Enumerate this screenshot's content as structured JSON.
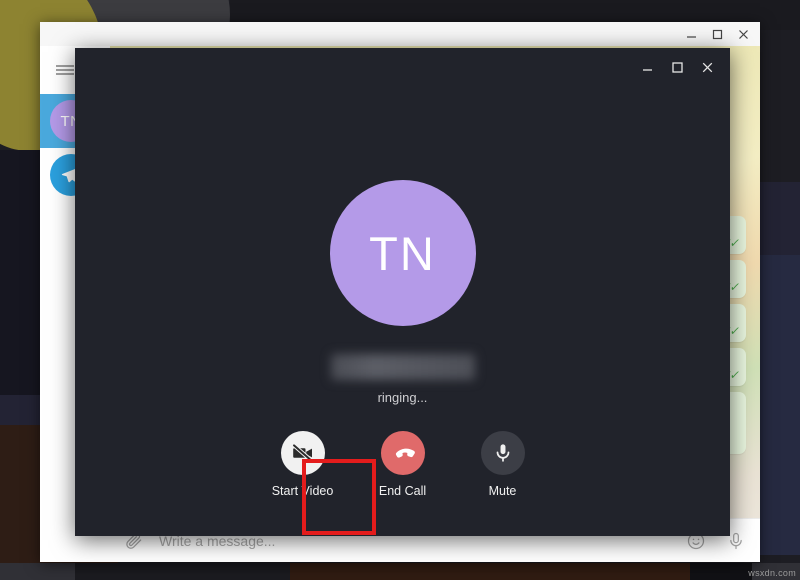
{
  "desktop": {
    "watermark": "wsxdn.com"
  },
  "telegram_window": {
    "title": "",
    "window_controls": {
      "minimize": "minimize-icon",
      "maximize": "maximize-icon",
      "close": "close-icon"
    },
    "sidebar": {
      "menu_icon": "hamburger-menu-icon",
      "chats": [
        {
          "avatar_initials": "TN",
          "selected": true,
          "avatar_color": "#b49ae8"
        },
        {
          "avatar_initials": "",
          "icon": "telegram-plane-icon",
          "selected": false,
          "avatar_color": "#2ba0de"
        }
      ]
    },
    "composer": {
      "attach_icon": "paperclip-icon",
      "placeholder": "Write a message...",
      "value": "",
      "emoji_icon": "smiley-icon",
      "voice_icon": "microphone-icon"
    },
    "messages": [
      {
        "status": "read",
        "ticks": "double-check"
      },
      {
        "status": "read",
        "ticks": "double-check"
      },
      {
        "status": "read",
        "ticks": "double-check"
      },
      {
        "status": "read",
        "ticks": "double-check"
      },
      {
        "status": "read",
        "ticks": "double-check"
      }
    ]
  },
  "call_window": {
    "window_controls": {
      "minimize": "minimize-icon",
      "maximize": "maximize-icon",
      "close": "close-icon"
    },
    "avatar_initials": "TN",
    "avatar_color": "#b49ae8",
    "contact_name": "",
    "contact_name_redacted": true,
    "status": "ringing...",
    "controls": [
      {
        "id": "start-video",
        "label": "Start Video",
        "icon": "video-off-icon",
        "style": "white",
        "highlighted": true
      },
      {
        "id": "end-call",
        "label": "End Call",
        "icon": "phone-hangup-icon",
        "style": "red",
        "highlighted": false
      },
      {
        "id": "mute",
        "label": "Mute",
        "icon": "microphone-icon",
        "style": "gray",
        "highlighted": false
      }
    ],
    "annotation": {
      "color": "#e41c1c",
      "targets": "start-video"
    }
  }
}
